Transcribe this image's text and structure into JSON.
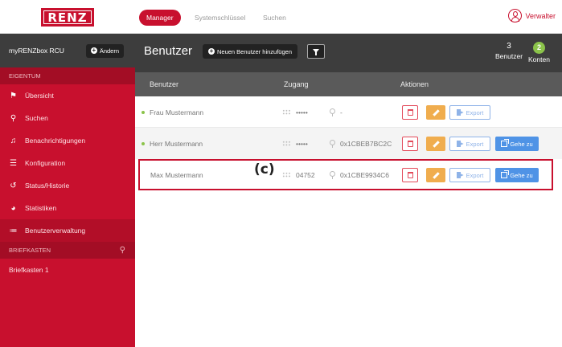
{
  "app": {
    "logo_text": "RENZ"
  },
  "topnav": {
    "tabs": [
      {
        "label": "Manager",
        "active": true
      },
      {
        "label": "Systemschlüssel",
        "active": false
      },
      {
        "label": "Suchen",
        "active": false
      }
    ],
    "user_label": "Verwalter",
    "user_icon": "user-circle-icon"
  },
  "sidebar": {
    "device_name": "myRENZbox RCU",
    "change_button": "Ändern",
    "section_property": "EIGENTUM",
    "items": [
      {
        "label": "Übersicht",
        "icon": "flag-icon",
        "glyph": "⚑"
      },
      {
        "label": "Suchen",
        "icon": "search-icon",
        "glyph": "⚲"
      },
      {
        "label": "Benachrichtigungen",
        "icon": "bell-icon",
        "glyph": "♫"
      },
      {
        "label": "Konfiguration",
        "icon": "sliders-icon",
        "glyph": "☰"
      },
      {
        "label": "Status/Historie",
        "icon": "history-icon",
        "glyph": "↺"
      },
      {
        "label": "Statistiken",
        "icon": "pie-chart-icon",
        "glyph": "◕"
      },
      {
        "label": "Benutzerverwaltung",
        "icon": "list-icon",
        "glyph": "≔",
        "active": true
      }
    ],
    "section_mailbox": "BRIEFKASTEN",
    "mailbox_search_icon": "search-icon",
    "mailbox_items": [
      "Briefkasten 1"
    ]
  },
  "main": {
    "title": "Benutzer",
    "add_user_button": "Neuen Benutzer hinzufügen",
    "filter_icon": "filter-icon",
    "stats": {
      "users_count": "3",
      "users_label": "Benutzer",
      "accounts_count": "2",
      "accounts_label": "Konten"
    },
    "table": {
      "headers": {
        "user": "Benutzer",
        "access": "Zugang",
        "actions": "Aktionen"
      },
      "rows": [
        {
          "name": "Frau Mustermann",
          "pin": "•••••",
          "key": "-",
          "status_dot": true,
          "has_goto": false
        },
        {
          "name": "Herr Mustermann",
          "pin": "•••••",
          "key": "0x1CBEB7BC2C",
          "status_dot": true,
          "has_goto": true
        },
        {
          "name": "Max Mustermann",
          "pin": "04752",
          "key": "0x1CBE9934C6",
          "status_dot": false,
          "has_goto": true
        }
      ],
      "export_label": "Export",
      "goto_label": "Gehe zu"
    },
    "annotation_label": "(c)"
  },
  "colors": {
    "brand_red": "#c8102e",
    "dark_header": "#3d3d3d",
    "edit_orange": "#f0ad4e",
    "goto_blue": "#4f93e6",
    "status_green": "#8bc34a"
  }
}
